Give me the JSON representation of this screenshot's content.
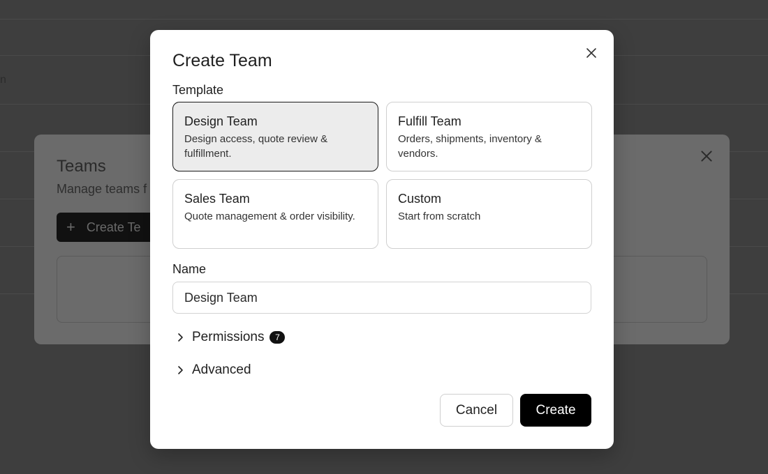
{
  "background": {
    "stub_text": "n"
  },
  "teams_dialog": {
    "title": "Teams",
    "description": "Manage teams f",
    "create_button_label": "Create Te"
  },
  "modal": {
    "title": "Create Team",
    "template_label": "Template",
    "templates": [
      {
        "name": "Design Team",
        "description": "Design access, quote review & fulfillment.",
        "selected": true
      },
      {
        "name": "Fulfill Team",
        "description": "Orders, shipments, inventory & vendors.",
        "selected": false
      },
      {
        "name": "Sales Team",
        "description": "Quote management & order visibility.",
        "selected": false
      },
      {
        "name": "Custom",
        "description": "Start from scratch",
        "selected": false
      }
    ],
    "name_label": "Name",
    "name_value": "Design Team",
    "permissions_label": "Permissions",
    "permissions_count": "7",
    "advanced_label": "Advanced",
    "cancel_label": "Cancel",
    "create_label": "Create"
  },
  "colors": {
    "primary": "#000000",
    "selected_card_bg": "#ececec",
    "overlay": "#3e3e3e"
  }
}
